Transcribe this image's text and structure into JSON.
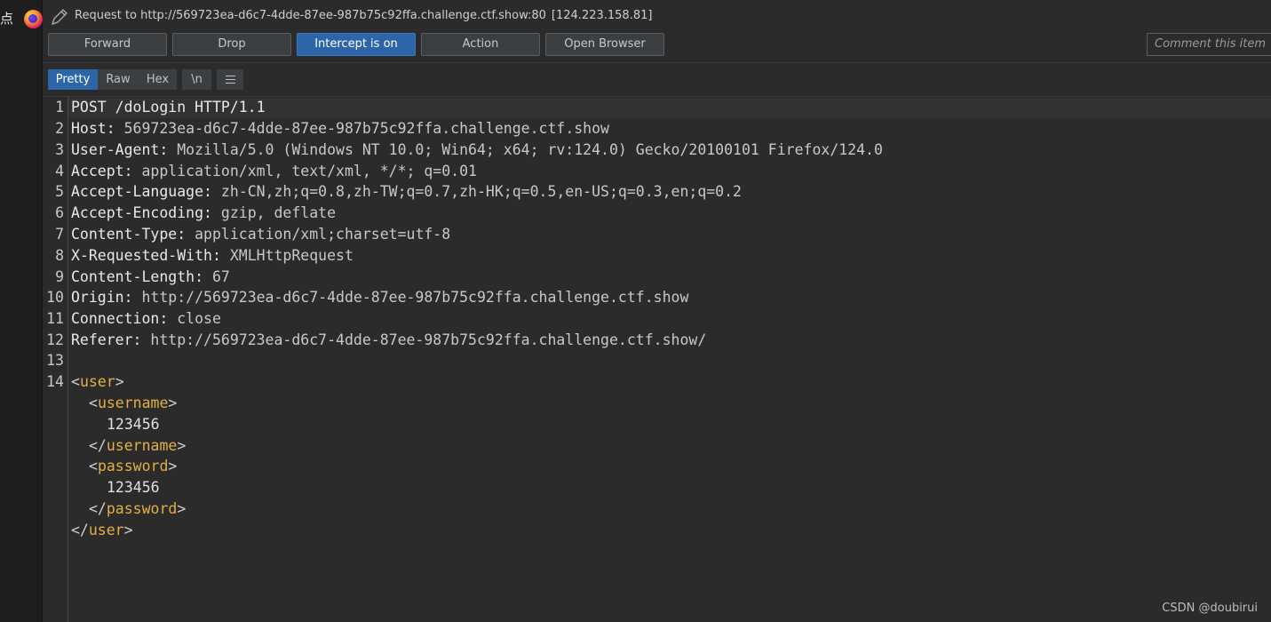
{
  "left_strip": {
    "glyph": "点",
    "browser_icon": "firefox-icon"
  },
  "header": {
    "icon": "pencil-icon",
    "request_label": "Request to http://569723ea-d6c7-4dde-87ee-987b75c92ffa.challenge.ctf.show:80",
    "ip": "[124.223.158.81]"
  },
  "toolbar": {
    "forward": "Forward",
    "drop": "Drop",
    "intercept": "Intercept is on",
    "action": "Action",
    "open_browser": "Open Browser",
    "comment_placeholder": "Comment this item"
  },
  "view_tabs": {
    "pretty": "Pretty",
    "raw": "Raw",
    "hex": "Hex",
    "newline": "\\n",
    "menu_icon": "hamburger-menu-icon",
    "selected": "Pretty"
  },
  "request": {
    "request_line": "POST /doLogin HTTP/1.1",
    "headers": [
      {
        "name": "Host",
        "value": "569723ea-d6c7-4dde-87ee-987b75c92ffa.challenge.ctf.show"
      },
      {
        "name": "User-Agent",
        "value": "Mozilla/5.0 (Windows NT 10.0; Win64; x64; rv:124.0) Gecko/20100101 Firefox/124.0"
      },
      {
        "name": "Accept",
        "value": "application/xml, text/xml, */*; q=0.01"
      },
      {
        "name": "Accept-Language",
        "value": "zh-CN,zh;q=0.8,zh-TW;q=0.7,zh-HK;q=0.5,en-US;q=0.3,en;q=0.2"
      },
      {
        "name": "Accept-Encoding",
        "value": "gzip, deflate"
      },
      {
        "name": "Content-Type",
        "value": "application/xml;charset=utf-8"
      },
      {
        "name": "X-Requested-With",
        "value": "XMLHttpRequest"
      },
      {
        "name": "Content-Length",
        "value": "67"
      },
      {
        "name": "Origin",
        "value": "http://569723ea-d6c7-4dde-87ee-987b75c92ffa.challenge.ctf.show"
      },
      {
        "name": "Connection",
        "value": "close"
      },
      {
        "name": "Referer",
        "value": "http://569723ea-d6c7-4dde-87ee-987b75c92ffa.challenge.ctf.show/"
      }
    ],
    "body": {
      "root_tag": "user",
      "username_tag": "username",
      "username_value": "123456",
      "password_tag": "password",
      "password_value": "123456"
    }
  },
  "line_numbers": [
    "1",
    "2",
    "3",
    "4",
    "5",
    "6",
    "7",
    "8",
    "9",
    "10",
    "11",
    "12",
    "13",
    "14"
  ],
  "watermark": "CSDN @doubirui",
  "colors": {
    "accent": "#2d66a8",
    "background": "#2b2b2b",
    "xml_tag": "#e2b043"
  }
}
